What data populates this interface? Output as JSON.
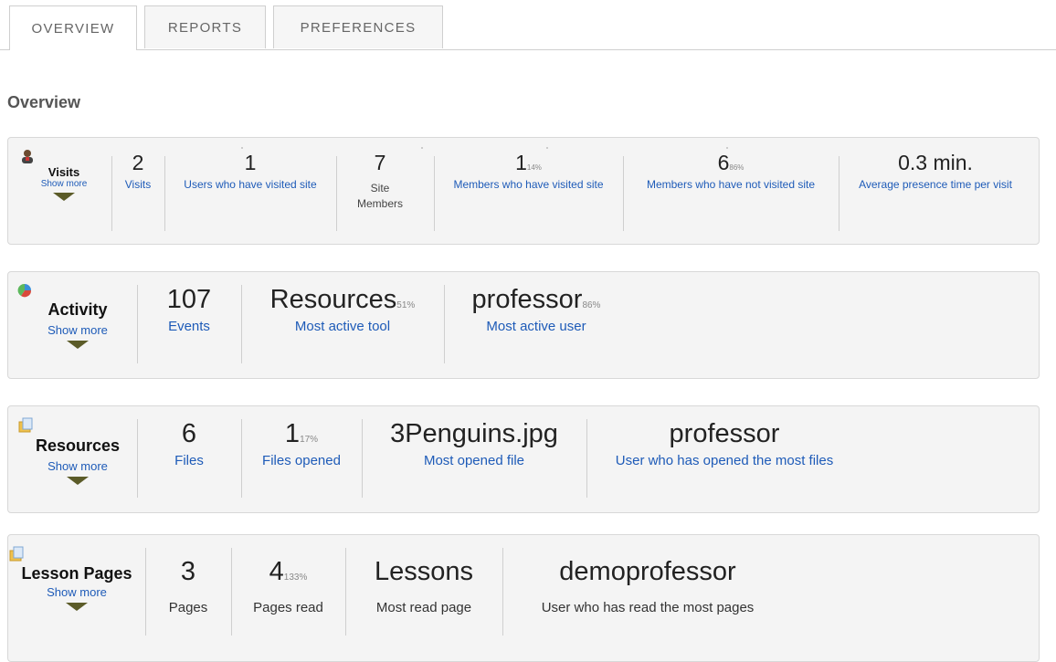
{
  "tabs": [
    {
      "label": "OVERVIEW"
    },
    {
      "label": "REPORTS"
    },
    {
      "label": "PREFERENCES"
    }
  ],
  "page_title": "Overview",
  "visits": {
    "title": "Visits",
    "show_more": "Show more",
    "stats": [
      {
        "value": "2",
        "pct": "",
        "label": "Visits"
      },
      {
        "value": "1",
        "pct": "",
        "label": "Users who have visited site"
      },
      {
        "value": "7",
        "pct": "",
        "label": "Site Members"
      },
      {
        "value": "1",
        "pct": "14%",
        "label": "Members who have visited site"
      },
      {
        "value": "6",
        "pct": "86%",
        "label": "Members who have not visited site"
      },
      {
        "value": "0.3 min.",
        "pct": "",
        "label": "Average presence time per visit"
      }
    ]
  },
  "activity": {
    "title": "Activity",
    "show_more": "Show more",
    "stats": [
      {
        "value": "107",
        "pct": "",
        "label": "Events"
      },
      {
        "value": "Resources",
        "pct": "51%",
        "label": "Most active tool"
      },
      {
        "value": "professor",
        "pct": "86%",
        "label": "Most active user"
      }
    ]
  },
  "resources": {
    "title": "Resources",
    "show_more": "Show more",
    "stats": [
      {
        "value": "6",
        "pct": "",
        "label": "Files"
      },
      {
        "value": "1",
        "pct": "17%",
        "label": "Files opened"
      },
      {
        "value": "3Penguins.jpg",
        "pct": "",
        "label": "Most opened file"
      },
      {
        "value": "professor",
        "pct": "",
        "label": "User who has opened the most files"
      }
    ]
  },
  "lessons": {
    "title": "Lesson Pages",
    "show_more": "Show more",
    "stats": [
      {
        "value": "3",
        "pct": "",
        "label": "Pages"
      },
      {
        "value": "4",
        "pct": "133%",
        "label": "Pages read"
      },
      {
        "value": "Lessons",
        "pct": "",
        "label": "Most read page"
      },
      {
        "value": "demoprofessor",
        "pct": "",
        "label": "User who has read the most pages"
      }
    ]
  },
  "colors": {
    "link": "#1e5bb8",
    "arrow": "#5b5b28",
    "panel_bg": "#f4f4f4"
  },
  "icons": {
    "visits": "user-icon",
    "activity": "pie-chart-icon",
    "resources": "document-icon",
    "lessons": "document-icon"
  }
}
